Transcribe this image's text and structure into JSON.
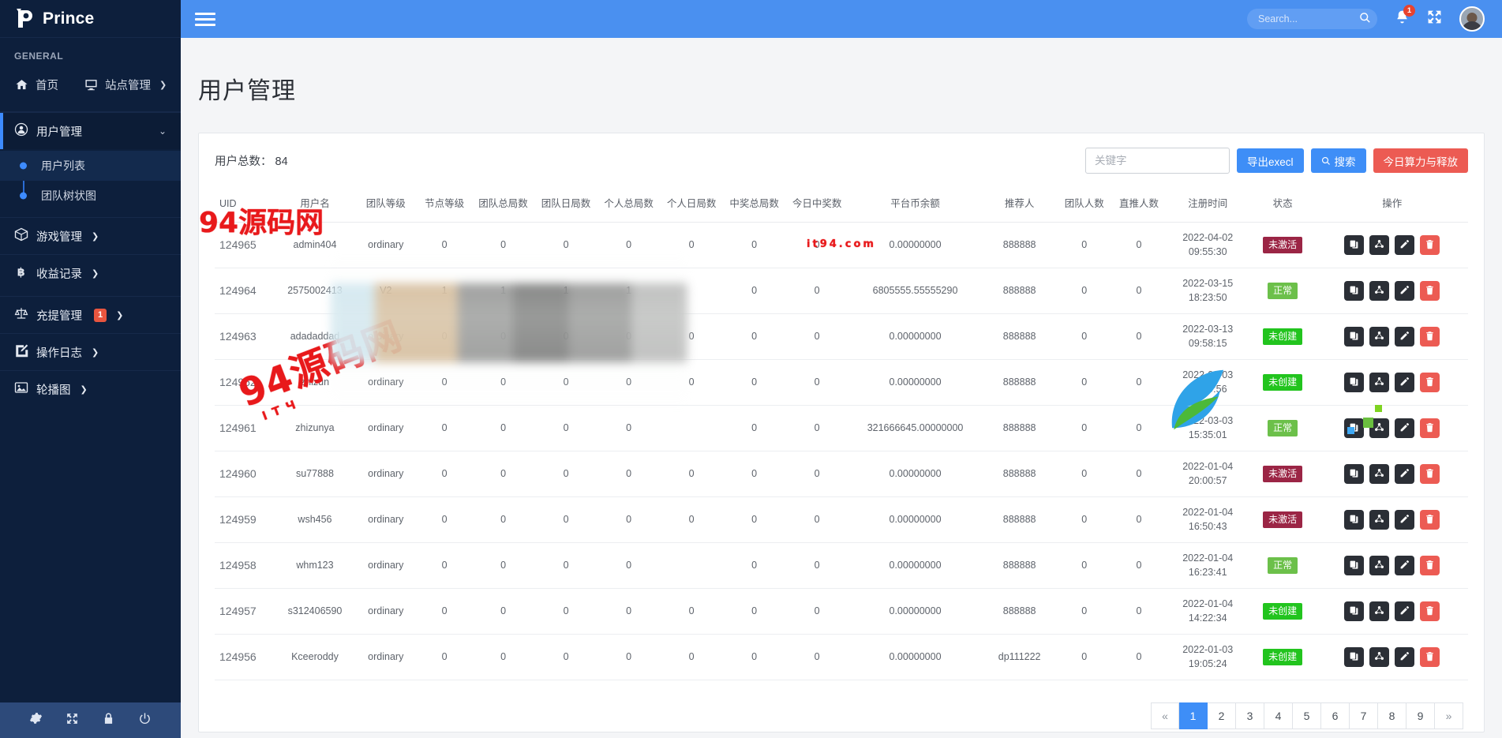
{
  "brand": {
    "name": "Prince",
    "logo_icon": "prince-p-logo"
  },
  "sidebar": {
    "section_title": "GENERAL",
    "top_items": [
      {
        "label": "首页",
        "icon": "home-icon"
      },
      {
        "label": "站点管理",
        "icon": "monitor-icon",
        "caret": "❯"
      }
    ],
    "user_mgmt": {
      "label": "用户管理",
      "icon": "user-circle-icon",
      "chevron": "⌄"
    },
    "submenu": [
      {
        "label": "用户列表",
        "selected": true
      },
      {
        "label": "团队树状图",
        "selected": false
      }
    ],
    "items": [
      {
        "label": "游戏管理",
        "icon": "box-icon",
        "caret": "❯",
        "badge": ""
      },
      {
        "label": "收益记录",
        "icon": "bitcoin-icon",
        "caret": "❯",
        "badge": ""
      },
      {
        "label": "充提管理",
        "icon": "scales-icon",
        "caret": "❯",
        "badge": "1"
      },
      {
        "label": "操作日志",
        "icon": "pencil-square-icon",
        "caret": "❯",
        "badge": ""
      },
      {
        "label": "轮播图",
        "icon": "image-icon",
        "caret": "❯",
        "badge": ""
      }
    ],
    "footer_icons": [
      "gear-icon",
      "expand-icon",
      "lock-icon",
      "power-icon"
    ]
  },
  "topbar": {
    "menu_icon": "hamburger-icon",
    "search_placeholder": "Search...",
    "search_value": "",
    "search_icon": "search-icon",
    "bell_icon": "bell-icon",
    "bell_count": "1",
    "fullscreen_icon": "expand-arrows-icon",
    "avatar_icon": "user-avatar"
  },
  "page": {
    "title": "用户管理",
    "total_label": "用户总数： 84"
  },
  "toolbar": {
    "keyword_placeholder": "关键字",
    "keyword_value": "",
    "export_label": "导出execl",
    "search_label": "搜索",
    "search_icon": "search-icon",
    "today_power_label": "今日算力与释放"
  },
  "table": {
    "columns": [
      "UID",
      "用户名",
      "团队等级",
      "节点等级",
      "团队总局数",
      "团队日局数",
      "个人总局数",
      "个人日局数",
      "中奖总局数",
      "今日中奖数",
      "平台币余额",
      "推荐人",
      "团队人数",
      "直推人数",
      "注册时间",
      "状态",
      "操作"
    ],
    "rows": [
      {
        "uid": "124965",
        "username": "admin404",
        "team_level": "ordinary",
        "node_level": "0",
        "team_total": "0",
        "team_daily": "0",
        "personal_total": "0",
        "personal_daily": "0",
        "win_total": "0",
        "win_today": "0",
        "balance": "0.00000000",
        "referrer": "888888",
        "team_people": "0",
        "direct_people": "0",
        "reg_date": "2022-04-02",
        "reg_time": "09:55:30",
        "status": "未激活",
        "status_type": "inactive"
      },
      {
        "uid": "124964",
        "username": "2575002413",
        "team_level": "V2",
        "node_level": "1",
        "team_total": "1",
        "team_daily": "1",
        "personal_total": "1",
        "personal_daily": "",
        "win_total": "0",
        "win_today": "0",
        "balance": "6805555.55555290",
        "referrer": "888888",
        "team_people": "0",
        "direct_people": "0",
        "reg_date": "2022-03-15",
        "reg_time": "18:23:50",
        "status": "正常",
        "status_type": "normal"
      },
      {
        "uid": "124963",
        "username": "adadaddad",
        "team_level": "ordinary",
        "node_level": "0",
        "team_total": "0",
        "team_daily": "0",
        "personal_total": "0",
        "personal_daily": "0",
        "win_total": "0",
        "win_today": "0",
        "balance": "0.00000000",
        "referrer": "888888",
        "team_people": "0",
        "direct_people": "0",
        "reg_date": "2022-03-13",
        "reg_time": "09:58:15",
        "status": "未创建",
        "status_type": "nocreate"
      },
      {
        "uid": "124962",
        "username": "zhizun",
        "team_level": "ordinary",
        "node_level": "0",
        "team_total": "0",
        "team_daily": "0",
        "personal_total": "0",
        "personal_daily": "0",
        "win_total": "0",
        "win_today": "0",
        "balance": "0.00000000",
        "referrer": "888888",
        "team_people": "0",
        "direct_people": "0",
        "reg_date": "2022-03-03",
        "reg_time": "15:49:56",
        "status": "未创建",
        "status_type": "nocreate"
      },
      {
        "uid": "124961",
        "username": "zhizunya",
        "team_level": "ordinary",
        "node_level": "0",
        "team_total": "0",
        "team_daily": "0",
        "personal_total": "0",
        "personal_daily": "",
        "win_total": "0",
        "win_today": "0",
        "balance": "321666645.00000000",
        "referrer": "888888",
        "team_people": "0",
        "direct_people": "0",
        "reg_date": "2022-03-03",
        "reg_time": "15:35:01",
        "status": "正常",
        "status_type": "normal"
      },
      {
        "uid": "124960",
        "username": "su77888",
        "team_level": "ordinary",
        "node_level": "0",
        "team_total": "0",
        "team_daily": "0",
        "personal_total": "0",
        "personal_daily": "0",
        "win_total": "0",
        "win_today": "0",
        "balance": "0.00000000",
        "referrer": "888888",
        "team_people": "0",
        "direct_people": "0",
        "reg_date": "2022-01-04",
        "reg_time": "20:00:57",
        "status": "未激活",
        "status_type": "inactive"
      },
      {
        "uid": "124959",
        "username": "wsh456",
        "team_level": "ordinary",
        "node_level": "0",
        "team_total": "0",
        "team_daily": "0",
        "personal_total": "0",
        "personal_daily": "0",
        "win_total": "0",
        "win_today": "0",
        "balance": "0.00000000",
        "referrer": "888888",
        "team_people": "0",
        "direct_people": "0",
        "reg_date": "2022-01-04",
        "reg_time": "16:50:43",
        "status": "未激活",
        "status_type": "inactive"
      },
      {
        "uid": "124958",
        "username": "whm123",
        "team_level": "ordinary",
        "node_level": "0",
        "team_total": "0",
        "team_daily": "0",
        "personal_total": "0",
        "personal_daily": "",
        "win_total": "0",
        "win_today": "0",
        "balance": "0.00000000",
        "referrer": "888888",
        "team_people": "0",
        "direct_people": "0",
        "reg_date": "2022-01-04",
        "reg_time": "16:23:41",
        "status": "正常",
        "status_type": "normal"
      },
      {
        "uid": "124957",
        "username": "s312406590",
        "team_level": "ordinary",
        "node_level": "0",
        "team_total": "0",
        "team_daily": "0",
        "personal_total": "0",
        "personal_daily": "0",
        "win_total": "0",
        "win_today": "0",
        "balance": "0.00000000",
        "referrer": "888888",
        "team_people": "0",
        "direct_people": "0",
        "reg_date": "2022-01-04",
        "reg_time": "14:22:34",
        "status": "未创建",
        "status_type": "nocreate"
      },
      {
        "uid": "124956",
        "username": "Kceeroddy",
        "team_level": "ordinary",
        "node_level": "0",
        "team_total": "0",
        "team_daily": "0",
        "personal_total": "0",
        "personal_daily": "0",
        "win_total": "0",
        "win_today": "0",
        "balance": "0.00000000",
        "referrer": "dp111222",
        "team_people": "0",
        "direct_people": "0",
        "reg_date": "2022-01-03",
        "reg_time": "19:05:24",
        "status": "未创建",
        "status_type": "nocreate"
      }
    ],
    "row_actions": [
      "copy-icon",
      "network-icon",
      "edit-pencil-icon",
      "delete-trash-icon"
    ]
  },
  "pagination": {
    "prev": "«",
    "pages": [
      "1",
      "2",
      "3",
      "4",
      "5",
      "6",
      "7",
      "8",
      "9"
    ],
    "next": "»",
    "active": "1"
  },
  "watermark": {
    "text": "94源码网",
    "sub": "ITЧ",
    "sub2": "it94.com"
  },
  "colors": {
    "sidebar_bg": "#0d1f3c",
    "topbar_blue": "#4a90f0",
    "accent_blue": "#3e8ef7",
    "danger_red": "#ec5b53",
    "status_normal": "#6cc04a",
    "status_inactive": "#9b2545",
    "status_nocreate": "#22c41e"
  }
}
